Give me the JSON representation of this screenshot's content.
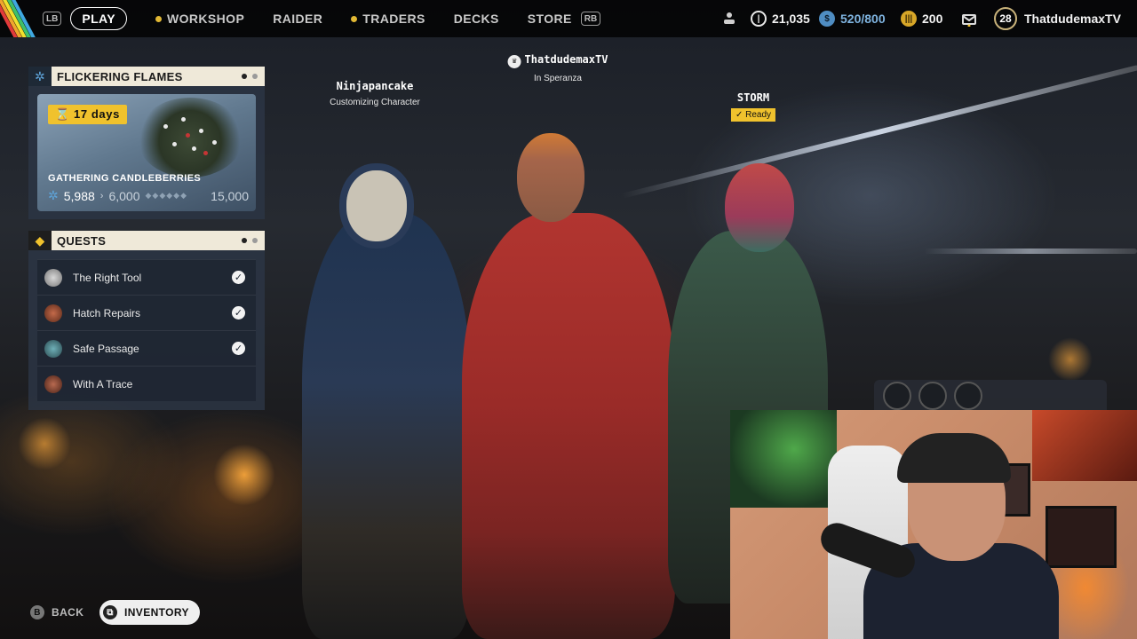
{
  "topbar": {
    "lb_hint": "LB",
    "rb_hint": "RB",
    "nav": [
      {
        "label": "PLAY",
        "active": true,
        "dot": false
      },
      {
        "label": "WORKSHOP",
        "active": false,
        "dot": true
      },
      {
        "label": "RAIDER",
        "active": false,
        "dot": false
      },
      {
        "label": "TRADERS",
        "active": false,
        "dot": true
      },
      {
        "label": "DECKS",
        "active": false,
        "dot": false
      },
      {
        "label": "STORE",
        "active": false,
        "dot": false
      }
    ],
    "currency_a": "21,035",
    "currency_b": "520/800",
    "currency_c": "200",
    "level": "28",
    "username": "ThatdudemaxTV"
  },
  "event": {
    "title": "FLICKERING FLAMES",
    "time_left": "17 days",
    "name": "GATHERING CANDLEBERRIES",
    "current": "5,988",
    "next": "6,000",
    "max": "15,000"
  },
  "quests": {
    "title": "QUESTS",
    "items": [
      {
        "label": "The Right Tool",
        "done": true
      },
      {
        "label": "Hatch Repairs",
        "done": true
      },
      {
        "label": "Safe Passage",
        "done": true
      },
      {
        "label": "With A Trace",
        "done": false
      }
    ]
  },
  "party": [
    {
      "name": "Ninjapancake",
      "status": "Customizing Character"
    },
    {
      "name": "ThatdudemaxTV",
      "status": "In Speranza"
    },
    {
      "name": "STORM",
      "status": "Ready"
    }
  ],
  "bottom": {
    "back_key": "B",
    "back_label": "BACK",
    "inventory_label": "INVENTORY"
  },
  "colors": {
    "accent_yellow": "#f0c22d",
    "panel_blue": "#2c3646",
    "header_cream": "#efe9d9"
  }
}
